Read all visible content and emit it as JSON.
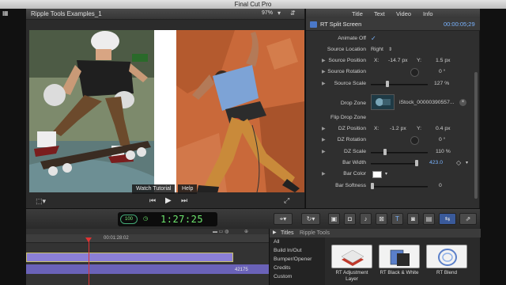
{
  "app": {
    "title": "Final Cut Pro"
  },
  "viewer": {
    "project_name": "Ripple Tools Examples_1",
    "zoom": "97%",
    "overlay_buttons": {
      "watch_tutorial": "Watch Tutorial",
      "help": "Help"
    }
  },
  "inspector": {
    "tabs": [
      "Title",
      "Text",
      "Video",
      "Info"
    ],
    "effect_name": "RT Split Screen",
    "timecode": "00:00:05;29",
    "rows": {
      "animate_off": "Animate Off",
      "source_location": {
        "label": "Source Location",
        "value": "Right"
      },
      "source_position": {
        "label": "Source Position",
        "x_label": "X:",
        "x": "-14.7 px",
        "y_label": "Y:",
        "y": "1.5 px"
      },
      "source_rotation": {
        "label": "Source Rotation",
        "value": "0 °"
      },
      "source_scale": {
        "label": "Source Scale",
        "value": "127 %"
      },
      "drop_zone": {
        "label": "Drop Zone",
        "file": "iStock_00000390557..."
      },
      "flip_drop_zone": {
        "label": "Flip Drop Zone"
      },
      "dz_position": {
        "label": "DZ Position",
        "x_label": "X:",
        "x": "-1.2 px",
        "y_label": "Y:",
        "y": "0.4 px"
      },
      "dz_rotation": {
        "label": "DZ Rotation",
        "value": "0 °"
      },
      "dz_scale": {
        "label": "DZ Scale",
        "value": "110 %"
      },
      "bar_width": {
        "label": "Bar Width",
        "value": "423.0"
      },
      "bar_color": {
        "label": "Bar Color"
      },
      "bar_softness": {
        "label": "Bar Softness",
        "value": "0"
      }
    }
  },
  "toolbar": {
    "tc_mode": "100",
    "timecode": "1:27:25"
  },
  "timeline": {
    "ruler_time": "00:01:28:02",
    "clip_label": "42175"
  },
  "browser": {
    "tab_titles": "Titles",
    "tab_ripple": "Ripple Tools",
    "categories": [
      "All",
      "Build In/Out",
      "Bumper/Opener",
      "Credits",
      "Custom"
    ],
    "effects": [
      {
        "label": "RT Adjustment Layer"
      },
      {
        "label": "RT Black & White"
      },
      {
        "label": "RT Blend"
      }
    ]
  }
}
